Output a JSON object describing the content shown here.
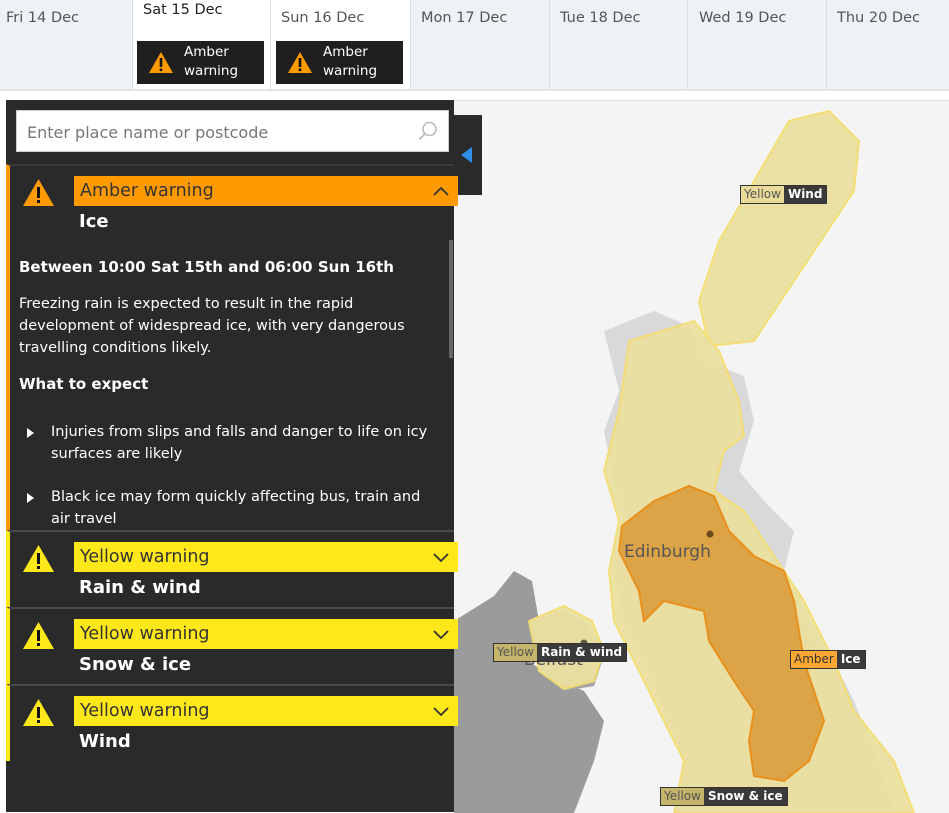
{
  "days": [
    {
      "label": "Fri 14 Dec",
      "warnings": []
    },
    {
      "label": "Sat 15 Dec",
      "selected": true,
      "warnings": [
        "Amber warning"
      ]
    },
    {
      "label": "Sun 16 Dec",
      "warnings": [
        "Amber warning"
      ]
    },
    {
      "label": "Mon 17 Dec",
      "warnings": []
    },
    {
      "label": "Tue 18 Dec",
      "warnings": []
    },
    {
      "label": "Wed 19 Dec",
      "warnings": []
    },
    {
      "label": "Thu 20 Dec",
      "warnings": []
    }
  ],
  "tab_warning_line1": "Amber",
  "tab_warning_line2": "warning",
  "search": {
    "placeholder": "Enter place name or postcode",
    "value": ""
  },
  "warnings": [
    {
      "level": "Amber warning",
      "type": "Ice",
      "expanded": true,
      "color": "#ff9a00",
      "period": "Between 10:00 Sat 15th and 06:00 Sun 16th",
      "description": "Freezing rain is expected to result in the rapid development of widespread ice, with very dangerous travelling conditions likely.",
      "what_to_expect_heading": "What to expect",
      "expectations": [
        "Injuries from slips and falls and danger to life on icy surfaces are likely",
        "Black ice may form quickly affecting bus, train and air travel"
      ]
    },
    {
      "level": "Yellow warning",
      "type": "Rain & wind",
      "expanded": false,
      "color": "#ffe81a"
    },
    {
      "level": "Yellow warning",
      "type": "Snow & ice",
      "expanded": false,
      "color": "#ffe81a"
    },
    {
      "level": "Yellow warning",
      "type": "Wind",
      "expanded": false,
      "color": "#ffe81a"
    }
  ],
  "map": {
    "cities": [
      "Edinburgh",
      "Belfast"
    ],
    "labels": [
      {
        "level": "Yellow",
        "type": "Wind"
      },
      {
        "level": "Amber",
        "type": "Ice"
      },
      {
        "level": "Yellow",
        "type": "Rain & wind"
      },
      {
        "level": "Yellow",
        "type": "Snow & ice"
      }
    ]
  },
  "icons": {
    "warning": "warning-triangle-icon",
    "search": "search-icon",
    "chevron_up": "chevron-up-icon",
    "chevron_down": "chevron-down-icon",
    "collapse": "collapse-panel-icon",
    "bullet": "bullet-triangle-icon"
  }
}
